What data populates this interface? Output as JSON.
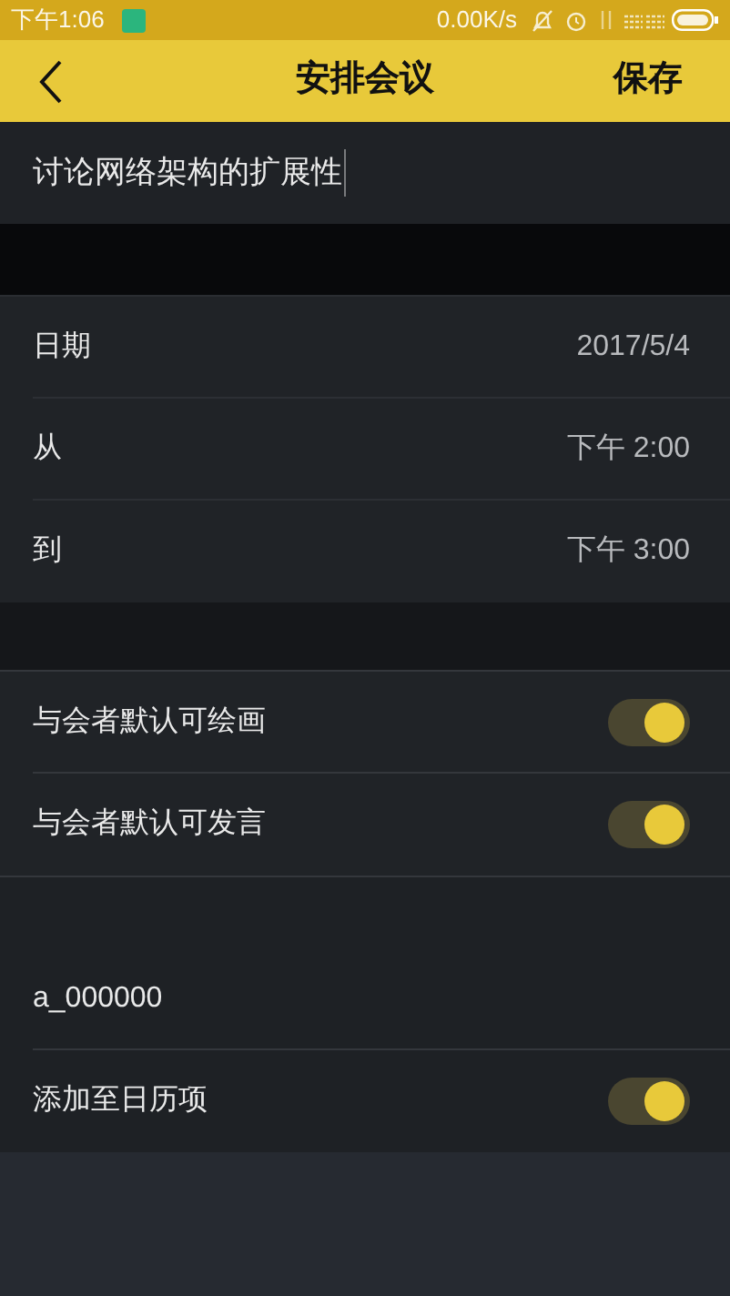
{
  "status_bar": {
    "time": "下午1:06",
    "speed": "0.00K/s"
  },
  "header": {
    "title": "安排会议",
    "action": "保存"
  },
  "topic": {
    "value": "讨论网络架构的扩展性"
  },
  "schedule": [
    {
      "label": "日期",
      "value": "2017/5/4"
    },
    {
      "label": "从",
      "value": "下午 2:00"
    },
    {
      "label": "到",
      "value": "下午 3:00"
    }
  ],
  "permissions": [
    {
      "label": "与会者默认可绘画",
      "on": true
    },
    {
      "label": "与会者默认可发言",
      "on": true
    }
  ],
  "account": {
    "text": "a_000000"
  },
  "calendar": {
    "label": "添加至日历项",
    "on": true
  }
}
